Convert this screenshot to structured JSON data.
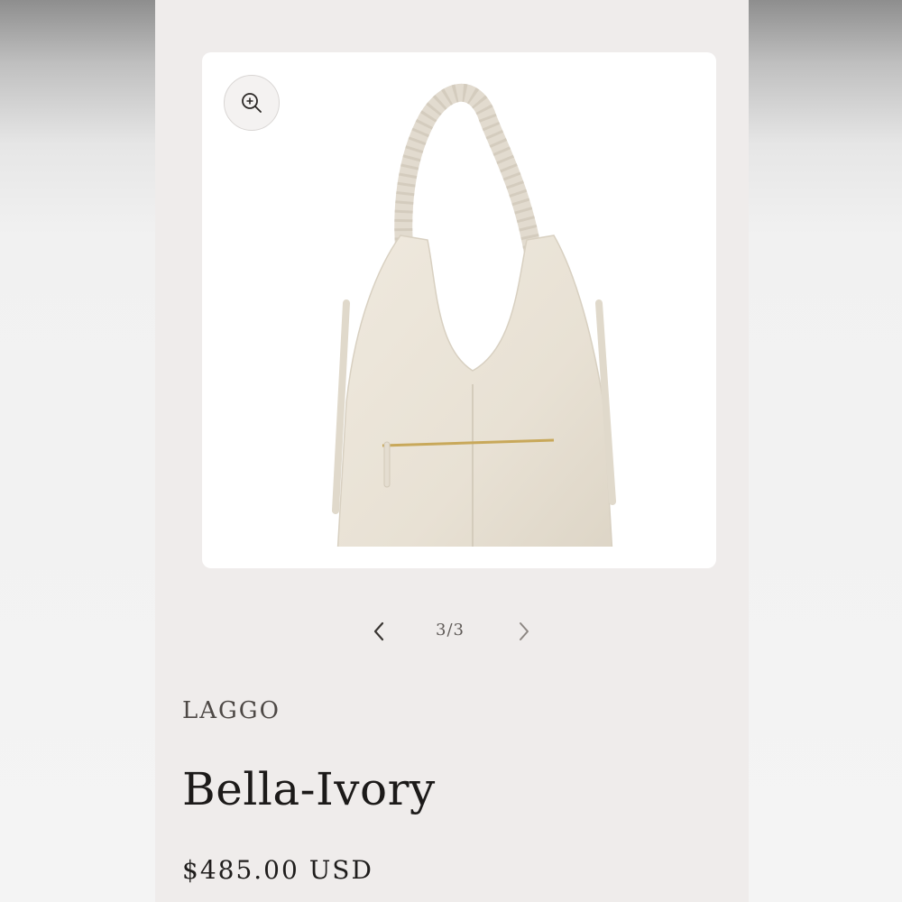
{
  "product": {
    "vendor": "LAGGO",
    "title": "Bella-Ivory",
    "price": "$485.00 USD"
  },
  "gallery": {
    "counter": "3/3",
    "current": 3,
    "total": 3,
    "zoom_icon": "zoom-in-icon",
    "prev_icon": "chevron-left-icon",
    "next_icon": "chevron-right-icon",
    "image": "ivory-hobo-bag"
  },
  "colors": {
    "page_background": "#efeceb",
    "card_background": "#ffffff",
    "bag_color": "#ebe5d9",
    "zipper_color": "#c8a85a",
    "text_primary": "#1c1a19"
  }
}
